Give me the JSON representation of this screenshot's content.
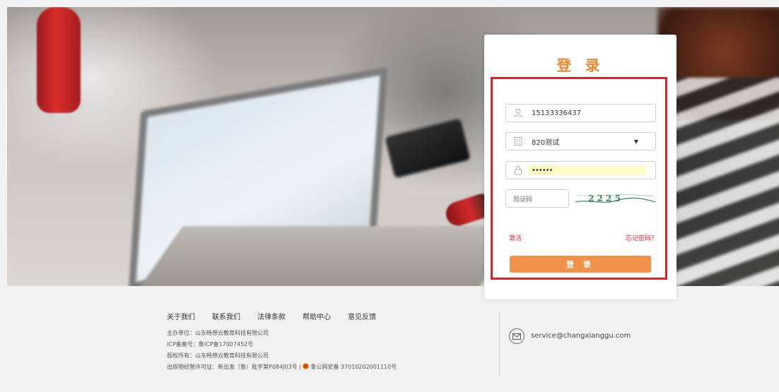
{
  "login": {
    "title": "登 录",
    "username_value": "15133336437",
    "school_value": "820测试",
    "password_mask": "••••••",
    "captcha_placeholder": "验证码",
    "captcha_text": "2 2 2 5",
    "activate_label": "激活",
    "forgot_label": "忘记密码？",
    "submit_label": "登 录"
  },
  "footer": {
    "nav": [
      "关于我们",
      "联系我们",
      "法律条款",
      "帮助中心",
      "意见反馈"
    ],
    "host": "主办单位：山东畅想云教育科技有限公司",
    "icp": "ICP备案号：鲁ICP备17007452号",
    "copyright": "版权所有：山东畅想云教育科技有限公司",
    "license": "出版物经营许可证：新出发（鲁）批字第P084J03号 |",
    "police": "鲁公网安备 37010202001110号",
    "email": "service@changxianggu.com"
  },
  "colors": {
    "accent": "#f0882f",
    "button": "#f0924a",
    "highlight_border": "#e3202a",
    "link": "#e3202a"
  }
}
